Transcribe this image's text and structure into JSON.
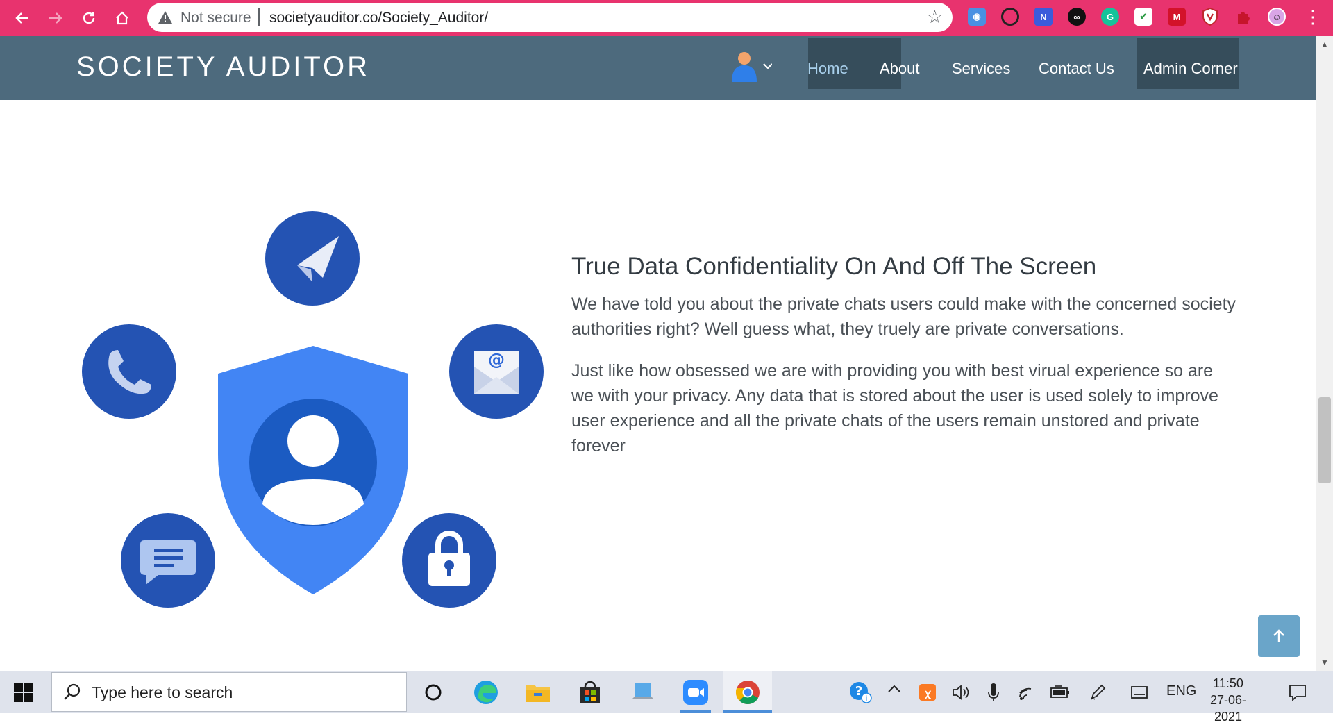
{
  "browser": {
    "security_label": "Not secure",
    "url": "societyauditor.co/Society_Auditor/",
    "nav_icons": [
      "back-arrow-icon",
      "forward-arrow-icon",
      "reload-icon",
      "home-icon"
    ],
    "extensions": [
      "camera-extension-icon",
      "circle-extension-icon",
      "n-extension-icon",
      "infinity-extension-icon",
      "grammarly-extension-icon",
      "checklist-extension-icon",
      "m-extension-icon",
      "shield-extension-icon",
      "puzzle-extensions-icon",
      "profile-avatar-icon"
    ],
    "theme_color": "#e8336e"
  },
  "site": {
    "brand": "SOCIETY AUDITOR",
    "nav": {
      "home": "Home",
      "about": "About",
      "services": "Services",
      "contact": "Contact Us",
      "admin": "Admin Corner"
    },
    "header_color": "#4d6a7d"
  },
  "section": {
    "title": "True Data Confidentiality On And Off The Screen",
    "paragraph1": "We have told you about the private chats users could make with the concerned society authorities right? Well guess what, they truely are private conversations.",
    "paragraph2": "Just like how obsessed we are with providing you with best virual experience so are we with your privacy. Any data that is stored about the user is used solely to improve user experience and all the private chats of the users remain unstored and private forever",
    "illustration_icons": [
      "shield-user-icon",
      "paper-plane-icon",
      "phone-icon",
      "email-icon",
      "chat-icon",
      "lock-icon"
    ]
  },
  "taskbar": {
    "search_placeholder": "Type here to search",
    "language": "ENG",
    "time": "11:50",
    "date": "27-06-2021"
  }
}
